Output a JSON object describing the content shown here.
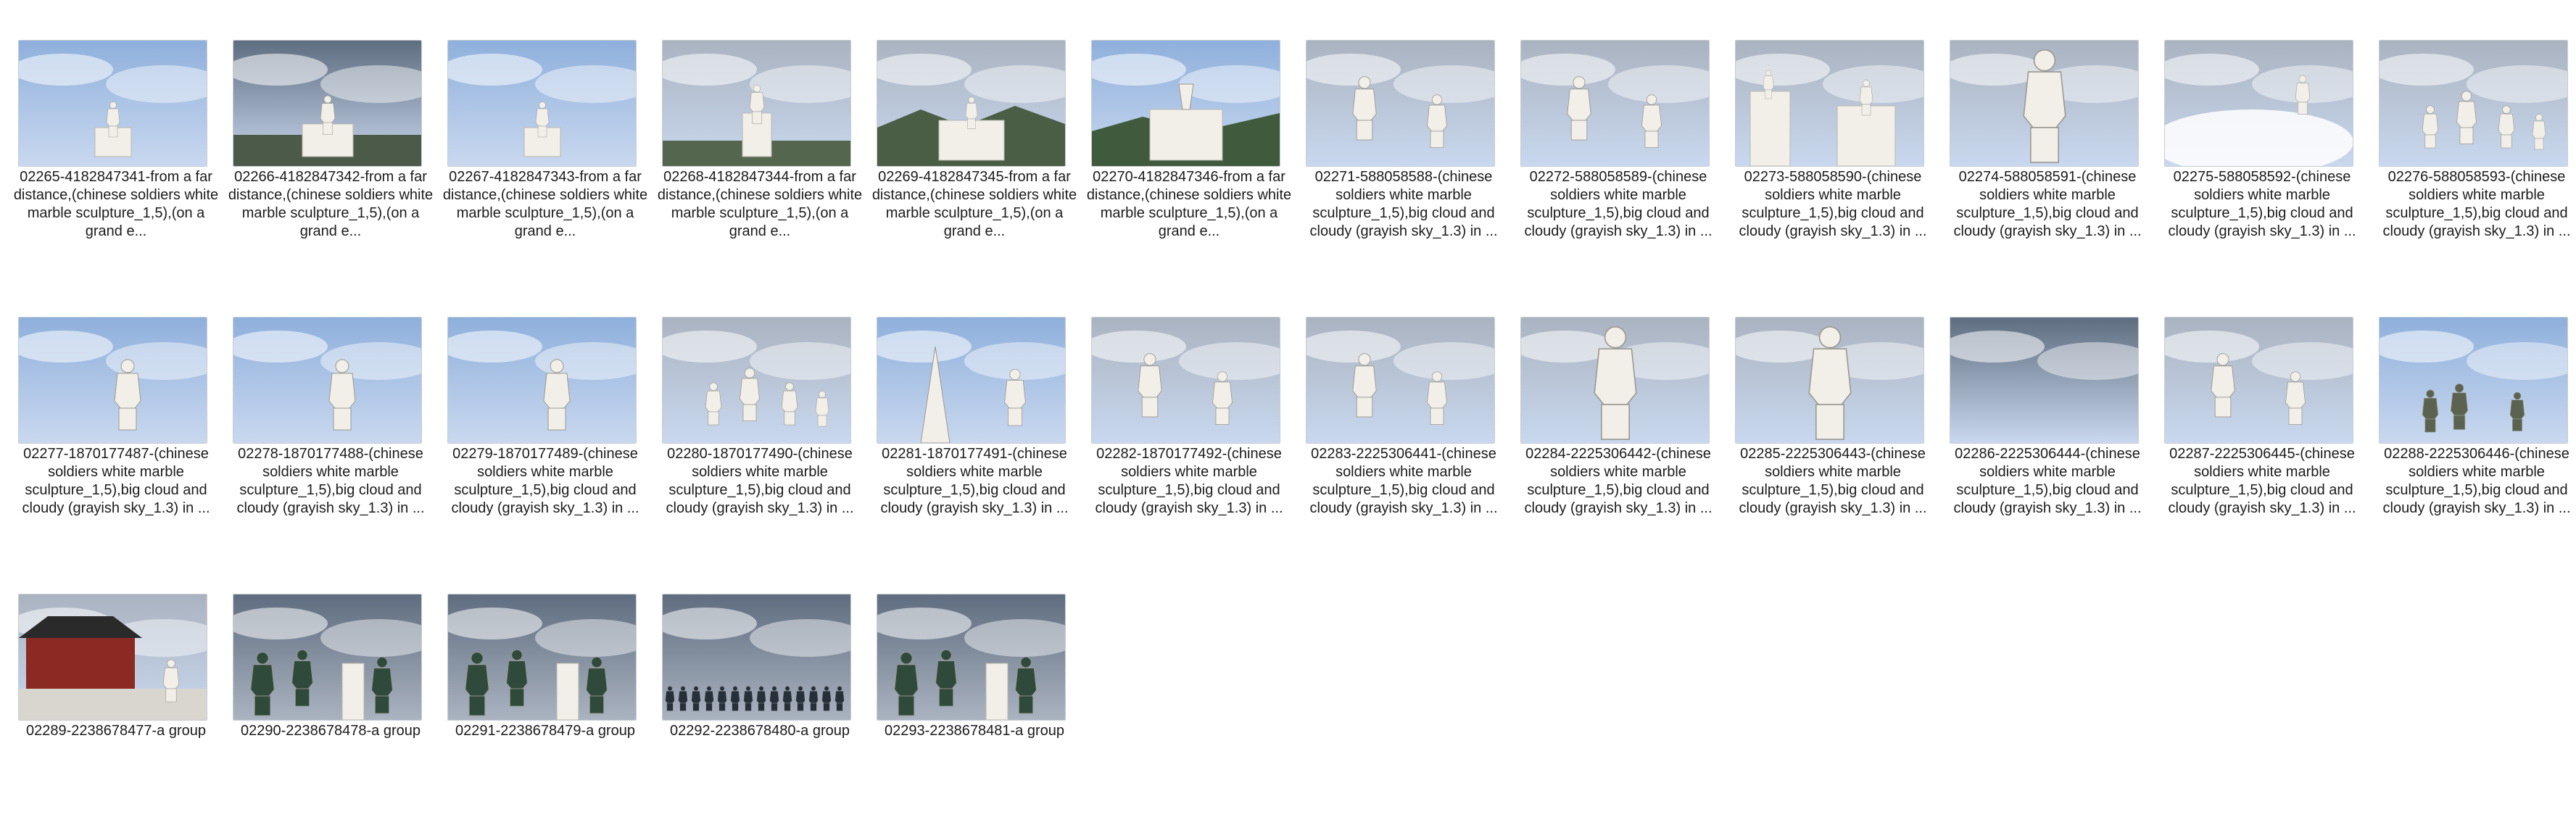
{
  "files": [
    {
      "label": "02265-4182847341-from a far distance,(chinese soldiers white marble sculpture_1,5),(on a grand e...",
      "scene": "distant"
    },
    {
      "label": "02266-4182847342-from a far distance,(chinese soldiers white marble sculpture_1,5),(on a grand e...",
      "scene": "distant-dark"
    },
    {
      "label": "02267-4182847343-from a far distance,(chinese soldiers white marble sculpture_1,5),(on a grand e...",
      "scene": "distant"
    },
    {
      "label": "02268-4182847344-from a far distance,(chinese soldiers white marble sculpture_1,5),(on a grand e...",
      "scene": "distant-grey"
    },
    {
      "label": "02269-4182847345-from a far distance,(chinese soldiers white marble sculpture_1,5),(on a grand e...",
      "scene": "distant-hills"
    },
    {
      "label": "02270-4182847346-from a far distance,(chinese soldiers white marble sculpture_1,5),(on a grand e...",
      "scene": "pagoda"
    },
    {
      "label": "02271-588058588-(chinese soldiers white marble sculpture_1,5),big cloud and cloudy (grayish sky_1.3) in ...",
      "scene": "two-statues"
    },
    {
      "label": "02272-588058589-(chinese soldiers white marble sculpture_1,5),big cloud and cloudy (grayish sky_1.3) in ...",
      "scene": "two-statues"
    },
    {
      "label": "02273-588058590-(chinese soldiers white marble sculpture_1,5),big cloud and cloudy (grayish sky_1.3) in ...",
      "scene": "monuments"
    },
    {
      "label": "02274-588058591-(chinese soldiers white marble sculpture_1,5),big cloud and cloudy (grayish sky_1.3) in ...",
      "scene": "bust"
    },
    {
      "label": "02275-588058592-(chinese soldiers white marble sculpture_1,5),big cloud and cloudy (grayish sky_1.3) in ...",
      "scene": "clouds-statue"
    },
    {
      "label": "02276-588058593-(chinese soldiers white marble sculpture_1,5),big cloud and cloudy (grayish sky_1.3) in ...",
      "scene": "group-statues"
    },
    {
      "label": "02277-1870177487-(chinese soldiers white marble sculpture_1,5),big cloud and cloudy (grayish sky_1.3) in ...",
      "scene": "single-statue"
    },
    {
      "label": "02278-1870177488-(chinese soldiers white marble sculpture_1,5),big cloud and cloudy (grayish sky_1.3) in ...",
      "scene": "single-statue"
    },
    {
      "label": "02279-1870177489-(chinese soldiers white marble sculpture_1,5),big cloud and cloudy (grayish sky_1.3) in ...",
      "scene": "single-statue"
    },
    {
      "label": "02280-1870177490-(chinese soldiers white marble sculpture_1,5),big cloud and cloudy (grayish sky_1.3) in ...",
      "scene": "group-statues"
    },
    {
      "label": "02281-1870177491-(chinese soldiers white marble sculpture_1,5),big cloud and cloudy (grayish sky_1.3) in ...",
      "scene": "spire"
    },
    {
      "label": "02282-1870177492-(chinese soldiers white marble sculpture_1,5),big cloud and cloudy (grayish sky_1.3) in ...",
      "scene": "two-statues"
    },
    {
      "label": "02283-2225306441-(chinese soldiers white marble sculpture_1,5),big cloud and cloudy (grayish sky_1.3) in ...",
      "scene": "two-statues"
    },
    {
      "label": "02284-2225306442-(chinese soldiers white marble sculpture_1,5),big cloud and cloudy (grayish sky_1.3) in ...",
      "scene": "bust"
    },
    {
      "label": "02285-2225306443-(chinese soldiers white marble sculpture_1,5),big cloud and cloudy (grayish sky_1.3) in ...",
      "scene": "bust"
    },
    {
      "label": "02286-2225306444-(chinese soldiers white marble sculpture_1,5),big cloud and cloudy (grayish sky_1.3) in ...",
      "scene": "sky-only"
    },
    {
      "label": "02287-2225306445-(chinese soldiers white marble sculpture_1,5),big cloud and cloudy (grayish sky_1.3) in ...",
      "scene": "two-statues"
    },
    {
      "label": "02288-2225306446-(chinese soldiers white marble sculpture_1,5),big cloud and cloudy (grayish sky_1.3) in ...",
      "scene": "group-small"
    },
    {
      "label": "02289-2238678477-a group",
      "scene": "temple"
    },
    {
      "label": "02290-2238678478-a group",
      "scene": "green-soldiers"
    },
    {
      "label": "02291-2238678479-a group",
      "scene": "green-soldiers"
    },
    {
      "label": "02292-2238678480-a group",
      "scene": "crowd-line"
    },
    {
      "label": "02293-2238678481-a group",
      "scene": "green-soldiers"
    }
  ],
  "colors": {
    "sky_light": "#c9d8ef",
    "sky_blue": "#8fb0dc",
    "sky_grey": "#aab3c0",
    "sky_dark": "#5f6d80",
    "marble": "#f1efe8",
    "uniform_green": "#2f4a3a",
    "temple_red": "#8a2a22"
  }
}
